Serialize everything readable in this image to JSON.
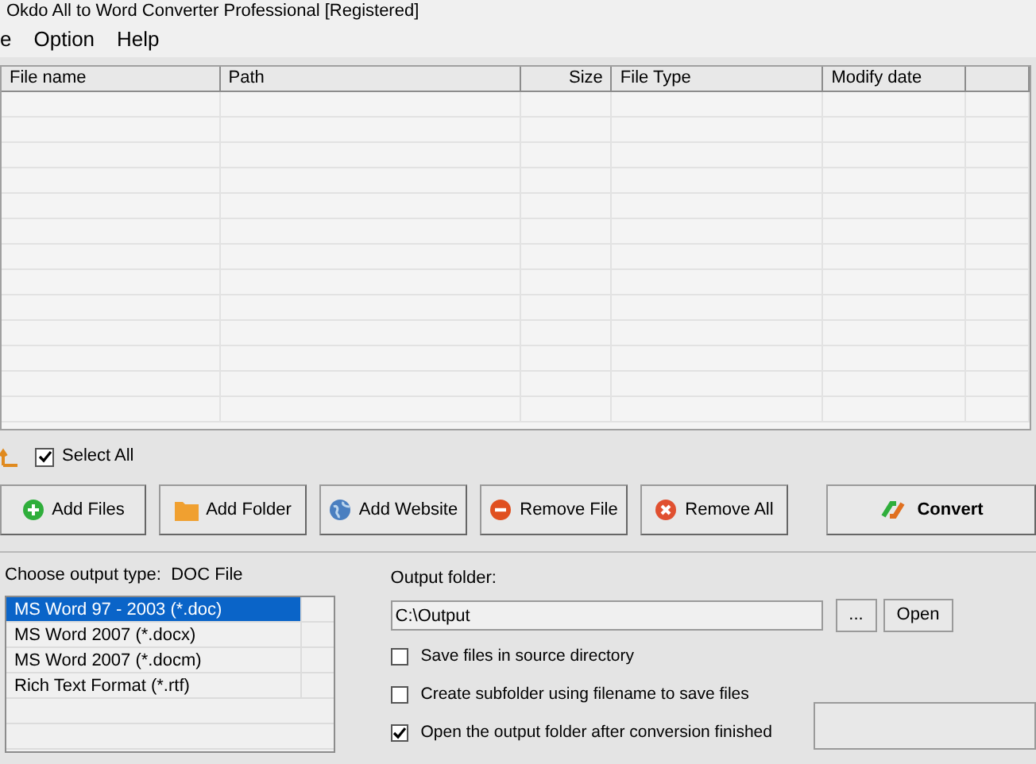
{
  "window": {
    "title": "Okdo All to Word Converter Professional [Registered]"
  },
  "menu": [
    "e",
    "Option",
    "Help"
  ],
  "table": {
    "columns": [
      {
        "label": "File name"
      },
      {
        "label": "Path"
      },
      {
        "label": "Size"
      },
      {
        "label": "File Type"
      },
      {
        "label": "Modify date"
      }
    ]
  },
  "select_all": {
    "label": "Select All",
    "checked": true
  },
  "buttons": [
    {
      "label": "Add Files",
      "kind": "add"
    },
    {
      "label": "Add Folder",
      "kind": "folder"
    },
    {
      "label": "Add Website",
      "kind": "globe"
    },
    {
      "label": "Remove File",
      "kind": "remove"
    },
    {
      "label": "Remove All",
      "kind": "clear"
    }
  ],
  "convert_button": {
    "label": "Convert"
  },
  "output_type": {
    "label": "Choose output type:",
    "value": "DOC File",
    "options": [
      {
        "label": "MS Word 97 - 2003 (*.doc)",
        "selected": true
      },
      {
        "label": "MS Word 2007 (*.docx)",
        "selected": false
      },
      {
        "label": "MS Word 2007 (*.docm)",
        "selected": false
      },
      {
        "label": "Rich Text Format (*.rtf)",
        "selected": false
      }
    ]
  },
  "output_folder": {
    "label": "Output folder:",
    "value": "C:\\Output",
    "browse": "...",
    "open": "Open"
  },
  "options": [
    {
      "label": "Save files in source directory",
      "checked": false
    },
    {
      "label": "Create subfolder using filename to save files",
      "checked": false
    },
    {
      "label": "Open the output folder after conversion finished",
      "checked": true
    }
  ]
}
